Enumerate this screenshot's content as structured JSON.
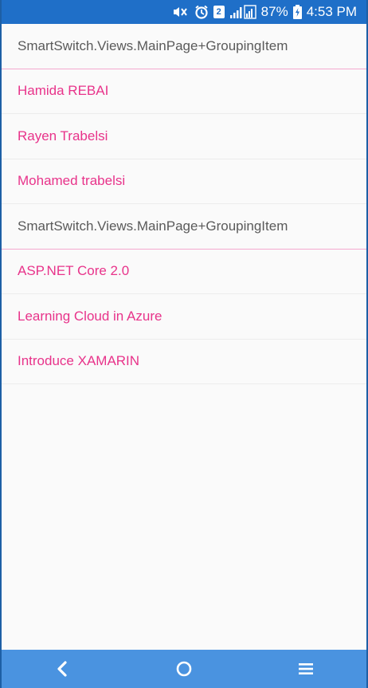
{
  "status_bar": {
    "battery_percent": "87%",
    "time": "4:53 PM",
    "sim_slot": "2",
    "icons": [
      "mute-vibrate-icon",
      "alarm-icon",
      "sim-icon",
      "signal-icon",
      "battery-charging-icon"
    ]
  },
  "groups": [
    {
      "header": "SmartSwitch.Views.MainPage+GroupingItem",
      "items": [
        "Hamida REBAI",
        "Rayen Trabelsi",
        "Mohamed trabelsi"
      ]
    },
    {
      "header": "SmartSwitch.Views.MainPage+GroupingItem",
      "items": [
        "ASP.NET Core 2.0",
        "Learning Cloud in Azure",
        "Introduce XAMARIN"
      ]
    }
  ],
  "nav_bar": {
    "icons": [
      "back-icon",
      "home-icon",
      "menu-icon"
    ]
  },
  "colors": {
    "status_bar": "#1f6fc8",
    "nav_bar": "#4a93e0",
    "item_text": "#e8338a",
    "group_text": "#5a5a5a",
    "group_divider": "#f4a9cf"
  }
}
